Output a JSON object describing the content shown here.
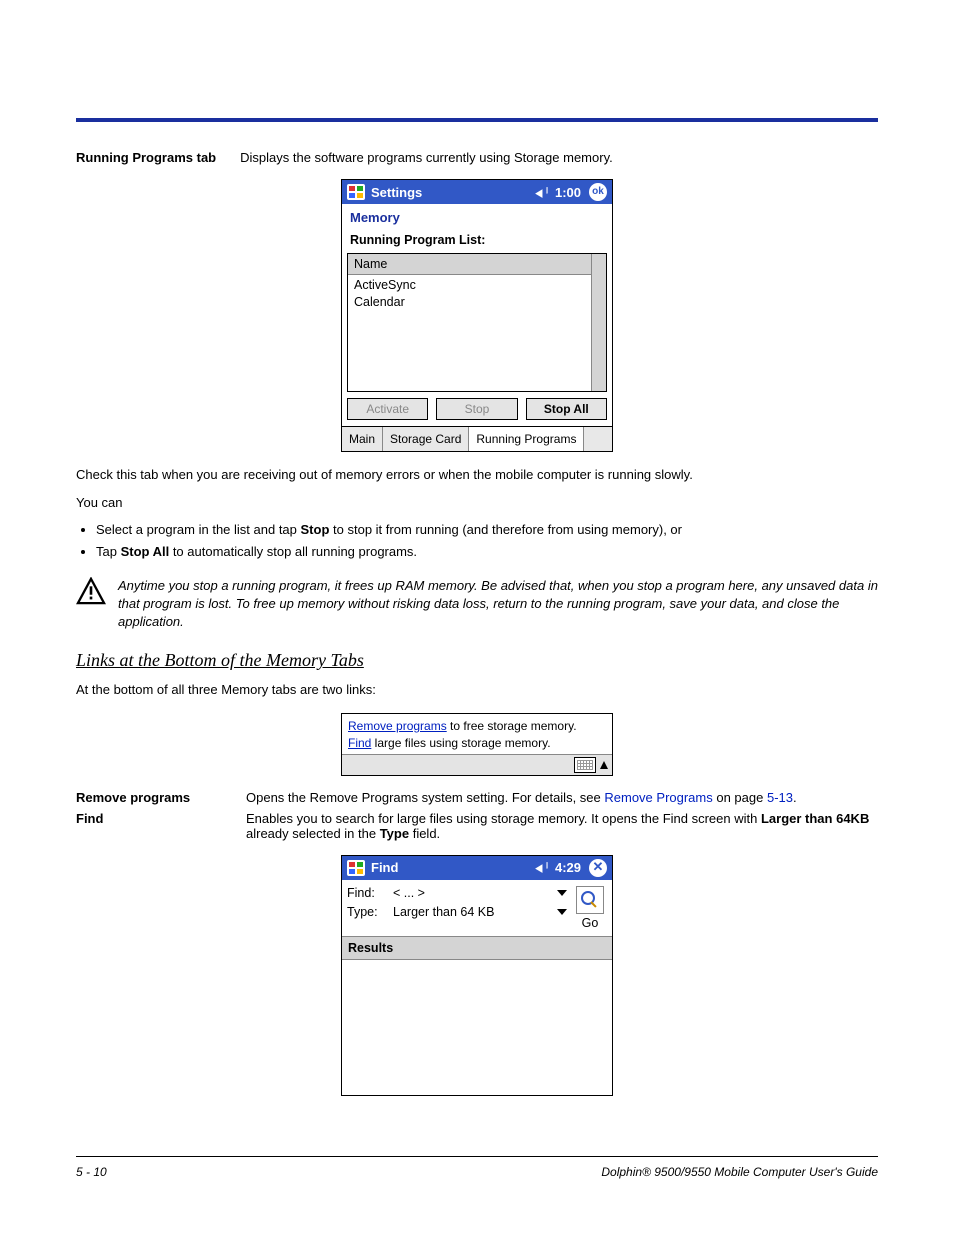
{
  "page": {
    "number": "5 - 10",
    "book": "Dolphin® 9500/9550 Mobile Computer User's Guide"
  },
  "intro": {
    "label_bold": "Running Programs",
    "label_suffix": " tab",
    "value": "Displays the software programs currently using Storage memory."
  },
  "screenshot_settings": {
    "title": "Settings",
    "time": "1:00",
    "ok": "ok",
    "section": "Memory",
    "list_label": "Running Program List:",
    "header": "Name",
    "items": [
      "ActiveSync",
      "Calendar"
    ],
    "buttons": {
      "activate": "Activate",
      "stop": "Stop",
      "stop_all": "Stop All"
    },
    "tabs": [
      "Main",
      "Storage Card",
      "Running Programs"
    ]
  },
  "para_check": "Check this tab when you are receiving out of memory errors or when the mobile computer is running slowly.",
  "para_youcan": "You can",
  "bullets": {
    "b1_pre": "Select a program in the list and tap ",
    "b1_bold": "Stop",
    "b1_post": " to stop it from running (and therefore from using memory), or",
    "b2_pre": "Tap ",
    "b2_bold": "Stop All",
    "b2_post": " to automatically stop all running programs."
  },
  "warning": "Anytime you stop a running program, it frees up RAM memory. Be advised that, when you stop a program here, any unsaved data in that program is lost. To free up memory without risking data loss, return to the running program, save your data, and close the application.",
  "heading_links": "Links at the Bottom of the Memory Tabs",
  "para_links_intro": "At the bottom of all three Memory tabs are two links:",
  "screenshot_links": {
    "line1_link": "Remove programs",
    "line1_post": " to free storage memory.",
    "line2_link": "Find",
    "line2_post": " large files using storage memory."
  },
  "remove_row": {
    "label": "Remove programs",
    "pre": "Opens the Remove Programs system setting. For details, see ",
    "xref": "Remove Programs",
    "mid": " on page ",
    "pageref": "5-13",
    "post": "."
  },
  "find_row": {
    "label": "Find",
    "pre": "Enables you to search for large files using storage memory. It opens the Find screen with ",
    "bold1": "Larger than 64KB",
    "mid": " already selected in the ",
    "bold2": "Type",
    "post": " field."
  },
  "screenshot_find": {
    "title": "Find",
    "time": "4:29",
    "close": "✕",
    "find_label": "Find:",
    "find_value": "<  ...  >",
    "type_label": "Type:",
    "type_value": "Larger than 64 KB",
    "go": "Go",
    "results": "Results"
  }
}
